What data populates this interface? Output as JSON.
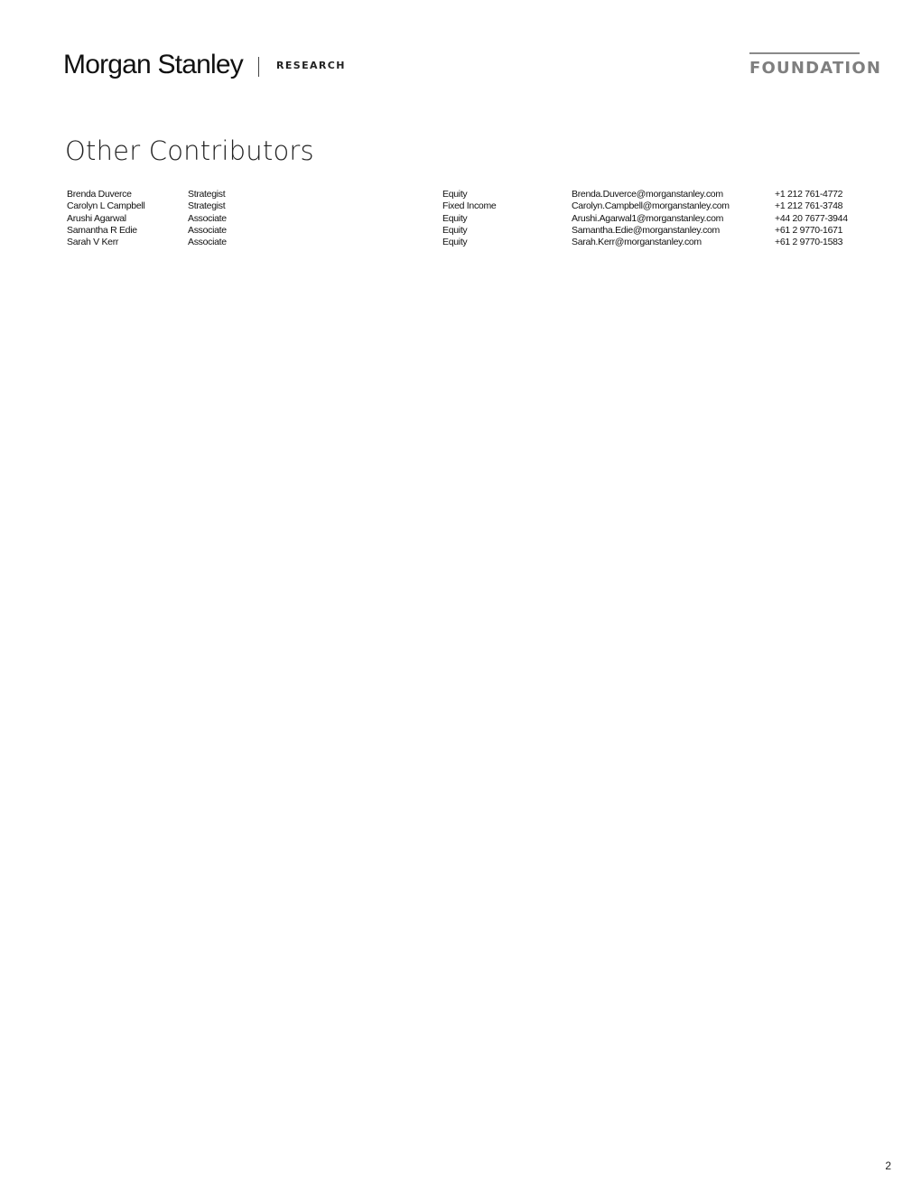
{
  "header": {
    "logo": "Morgan Stanley",
    "division": "RESEARCH",
    "badge": "FOUNDATION"
  },
  "title": "Other Contributors",
  "contributors": [
    {
      "name": "Brenda Duverce",
      "role": "Strategist",
      "department": "Equity",
      "email": "Brenda.Duverce@morganstanley.com",
      "phone": "+1 212 761-4772"
    },
    {
      "name": "Carolyn L Campbell",
      "role": "Strategist",
      "department": "Fixed Income",
      "email": "Carolyn.Campbell@morganstanley.com",
      "phone": "+1 212 761-3748"
    },
    {
      "name": "Arushi Agarwal",
      "role": "Associate",
      "department": "Equity",
      "email": "Arushi.Agarwal1@morganstanley.com",
      "phone": "+44 20 7677-3944"
    },
    {
      "name": "Samantha R Edie",
      "role": "Associate",
      "department": "Equity",
      "email": "Samantha.Edie@morganstanley.com",
      "phone": "+61 2 9770-1671"
    },
    {
      "name": "Sarah V Kerr",
      "role": "Associate",
      "department": "Equity",
      "email": "Sarah.Kerr@morganstanley.com",
      "phone": "+61 2 9770-1583"
    }
  ],
  "page_number": "2"
}
